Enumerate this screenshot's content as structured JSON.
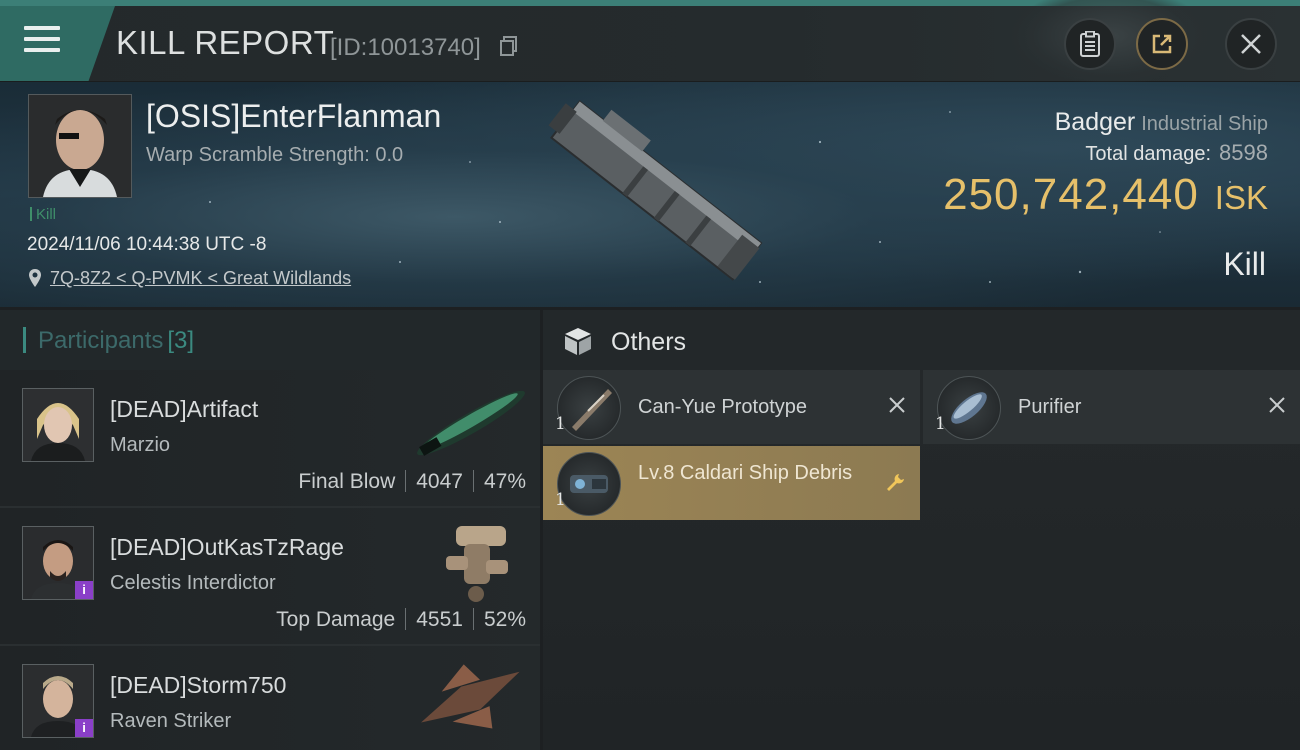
{
  "header": {
    "title": "KILL REPORT",
    "report_id": "[ID:10013740]"
  },
  "victim": {
    "name": "[OSIS]EnterFlanman",
    "warp_scramble": "Warp Scramble Strength: 0.0",
    "tag": "Kill",
    "datetime": "2024/11/06 10:44:38 UTC -8",
    "location": "7Q-8Z2 < Q-PVMK < Great Wildlands",
    "ship_name": "Badger",
    "ship_class": "Industrial Ship",
    "total_damage_label": "Total damage:",
    "total_damage": "8598",
    "isk_value": "250,742,440",
    "isk_unit": "ISK",
    "result": "Kill"
  },
  "participants": {
    "title": "Participants",
    "count": "[3]",
    "rows": [
      {
        "name": "[DEAD]Artifact",
        "ship": "Marzio",
        "role": "Final Blow",
        "damage": "4047",
        "percent": "47%"
      },
      {
        "name": "[DEAD]OutKasTzRage",
        "ship": "Celestis Interdictor",
        "role": "Top Damage",
        "damage": "4551",
        "percent": "52%"
      },
      {
        "name": "[DEAD]Storm750",
        "ship": "Raven Striker"
      }
    ]
  },
  "others": {
    "title": "Others",
    "items": [
      {
        "name": "Can-Yue Prototype",
        "qty": "1"
      },
      {
        "name": "Purifier",
        "qty": "1"
      },
      {
        "name": "Lv.8 Caldari Ship Debris",
        "qty": "1"
      }
    ]
  },
  "colors": {
    "accent_teal": "#2f6b63",
    "isk_gold": "#e6c06a",
    "highlight_item": "#9c8555",
    "badge_purple": "#8a3fc8"
  },
  "icons": [
    "menu-icon",
    "copy-icon",
    "clipboard-icon",
    "share-icon",
    "close-icon",
    "location-pin-icon",
    "box-icon",
    "x-icon",
    "wrench-icon",
    "info-badge-icon"
  ]
}
